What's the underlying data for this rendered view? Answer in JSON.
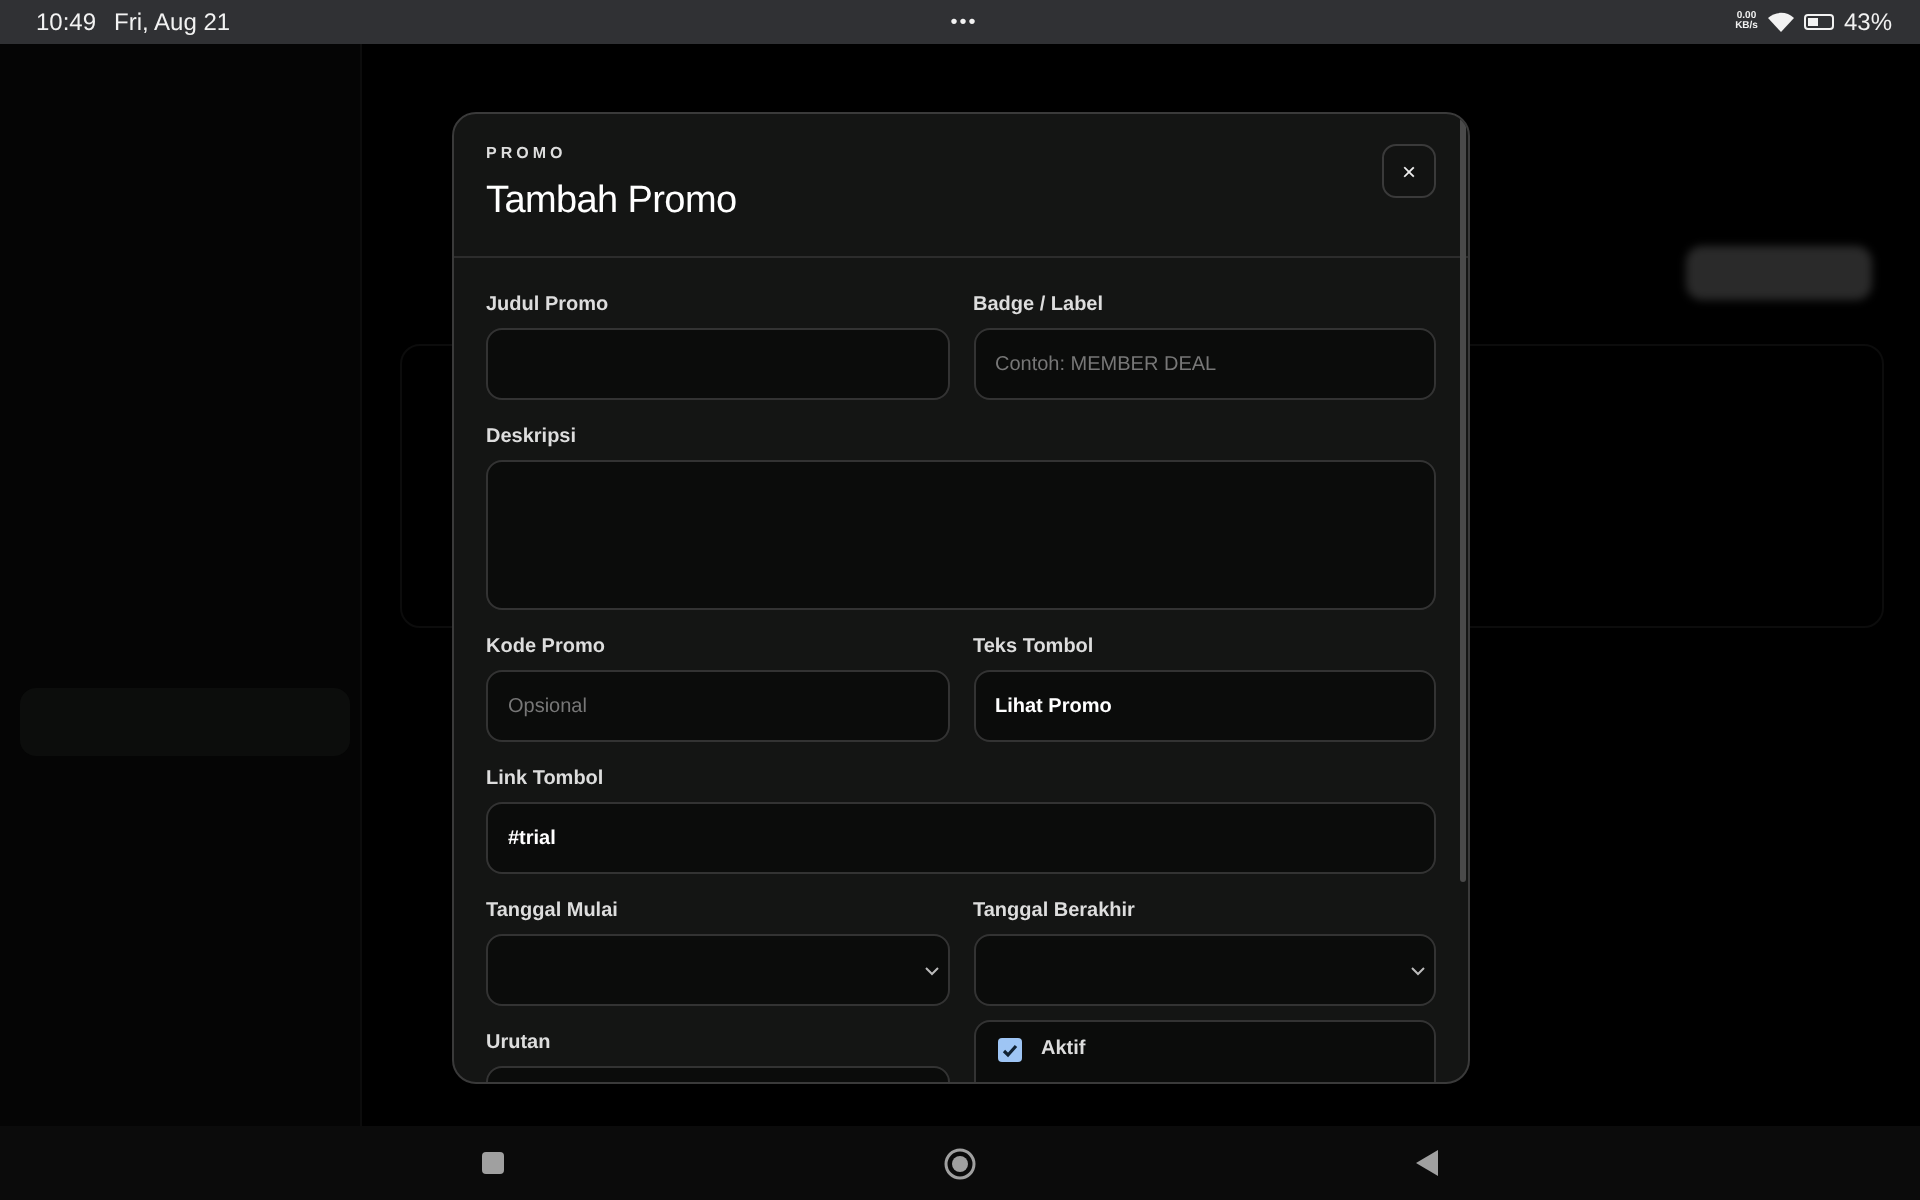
{
  "status_bar": {
    "time": "10:49",
    "date": "Fri, Aug 21",
    "menu": "•••",
    "net_speed": "0.00",
    "net_unit": "KB/s",
    "battery": "43%"
  },
  "modal": {
    "eyebrow": "PROMO",
    "title": "Tambah Promo",
    "close": "×",
    "fields": [
      {
        "kind": "text",
        "label": "Judul Promo",
        "wide": false
      },
      {
        "kind": "text",
        "label": "Badge / Label",
        "placeholder": "Contoh: MEMBER DEAL",
        "wide": false
      },
      {
        "kind": "textarea",
        "label": "Deskripsi",
        "wide": true
      },
      {
        "kind": "text",
        "label": "Kode Promo",
        "placeholder": "Opsional",
        "wide": false
      },
      {
        "kind": "text",
        "label": "Teks Tombol",
        "value": "Lihat Promo",
        "wide": false
      },
      {
        "kind": "text",
        "label": "Link Tombol",
        "value": "#trial",
        "wide": true
      },
      {
        "kind": "select",
        "label": "Tanggal Mulai",
        "wide": false
      },
      {
        "kind": "select",
        "label": "Tanggal Berakhir",
        "wide": false
      },
      {
        "kind": "text",
        "label": "Urutan",
        "wide": false
      },
      {
        "kind": "checkbox",
        "label": "Aktif",
        "checked": true,
        "wide": false
      }
    ]
  }
}
